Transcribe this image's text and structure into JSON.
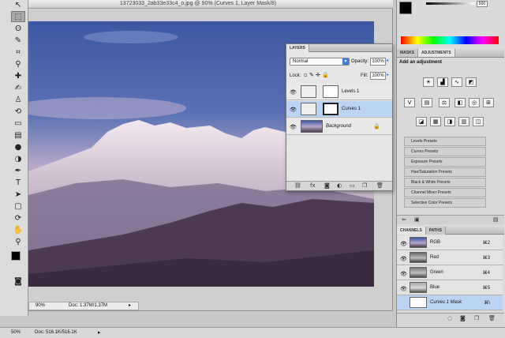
{
  "document": {
    "title": "13723033_2ab33e33c4_o.jpg @ 90% (Curves 1, Layer Mask/8)",
    "zoom": "90%",
    "doc_size": "Doc: 1.37M/1.37M"
  },
  "app_status": {
    "zoom": "50%",
    "doc_size": "Doc: 516.1K/516.1K"
  },
  "layers_panel": {
    "tab": "LAYERS",
    "blend_mode": "Normal",
    "opacity_label": "Opacity:",
    "opacity_value": "100%",
    "lock_label": "Lock:",
    "fill_label": "Fill:",
    "fill_value": "100%",
    "layers": [
      {
        "name": "Levels 1",
        "selected": false
      },
      {
        "name": "Curves 1",
        "selected": true
      },
      {
        "name": "Background",
        "selected": false
      }
    ]
  },
  "color_panel": {
    "value": "500"
  },
  "adjust_panel": {
    "tabs": [
      "MASKS",
      "ADJUSTMENTS"
    ],
    "subtitle": "Add an adjustment",
    "presets": [
      "Levels Presets",
      "Curves Presets",
      "Exposure Presets",
      "Hue/Saturation Presets",
      "Black & White Presets",
      "Channel Mixer Presets",
      "Selective Color Presets"
    ]
  },
  "channels_panel": {
    "tabs": [
      "CHANNELS",
      "PATHS"
    ],
    "channels": [
      {
        "name": "RGB",
        "shortcut": "⌘2"
      },
      {
        "name": "Red",
        "shortcut": "⌘3"
      },
      {
        "name": "Green",
        "shortcut": "⌘4"
      },
      {
        "name": "Blue",
        "shortcut": "⌘5"
      },
      {
        "name": "Curves 1 Mask",
        "shortcut": "⌘\\"
      }
    ]
  },
  "colors": {
    "accent": "#bcd4f4",
    "sky_top": "#3d58a3",
    "sky_bottom": "#b8a9c9",
    "mountain": "#4d3a52"
  }
}
